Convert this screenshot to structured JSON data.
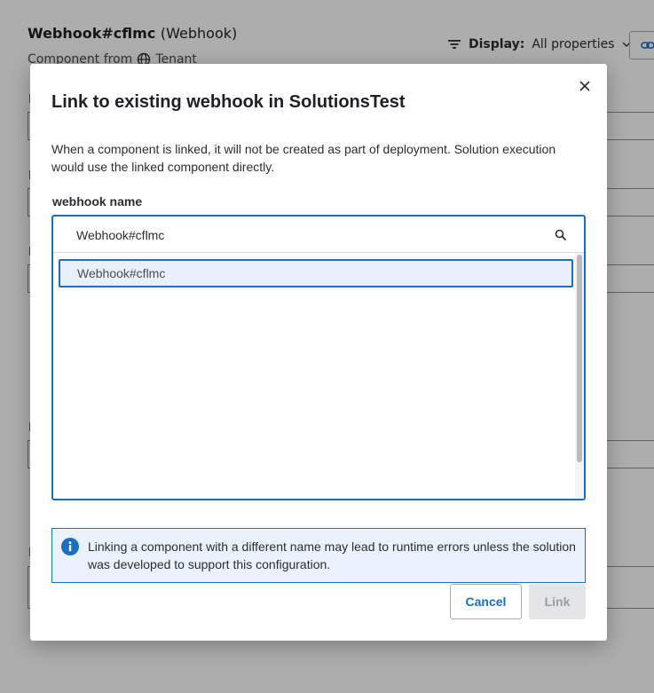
{
  "background": {
    "component_name": "Webhook#cflmc",
    "component_type": "(Webhook)",
    "component_from_label": "Component from",
    "component_from_value": "Tenant",
    "display_label": "Display:",
    "display_value": "All properties",
    "icons": [
      "filter-icon",
      "globe-icon",
      "chevron-down-icon",
      "link-icon"
    ]
  },
  "dialog": {
    "title": "Link to existing webhook in SolutionsTest",
    "description": "When a component is linked, it will not be created as part of deployment. Solution execution would use the linked component directly.",
    "field_label": "webhook name",
    "search_value": "Webhook#cflmc",
    "options": [
      "Webhook#cflmc"
    ],
    "info_message": "Linking a component with a different name may lead to runtime errors unless the solution was developed to support this configuration.",
    "cancel_label": "Cancel",
    "link_label": "Link",
    "icons": [
      "close-icon",
      "search-icon",
      "info-icon"
    ]
  },
  "colors": {
    "accent": "#1b6ec2",
    "info_bg": "#eaf2fc",
    "option_bg": "#e8f0fb",
    "disabled_bg": "#e4e5e6"
  }
}
